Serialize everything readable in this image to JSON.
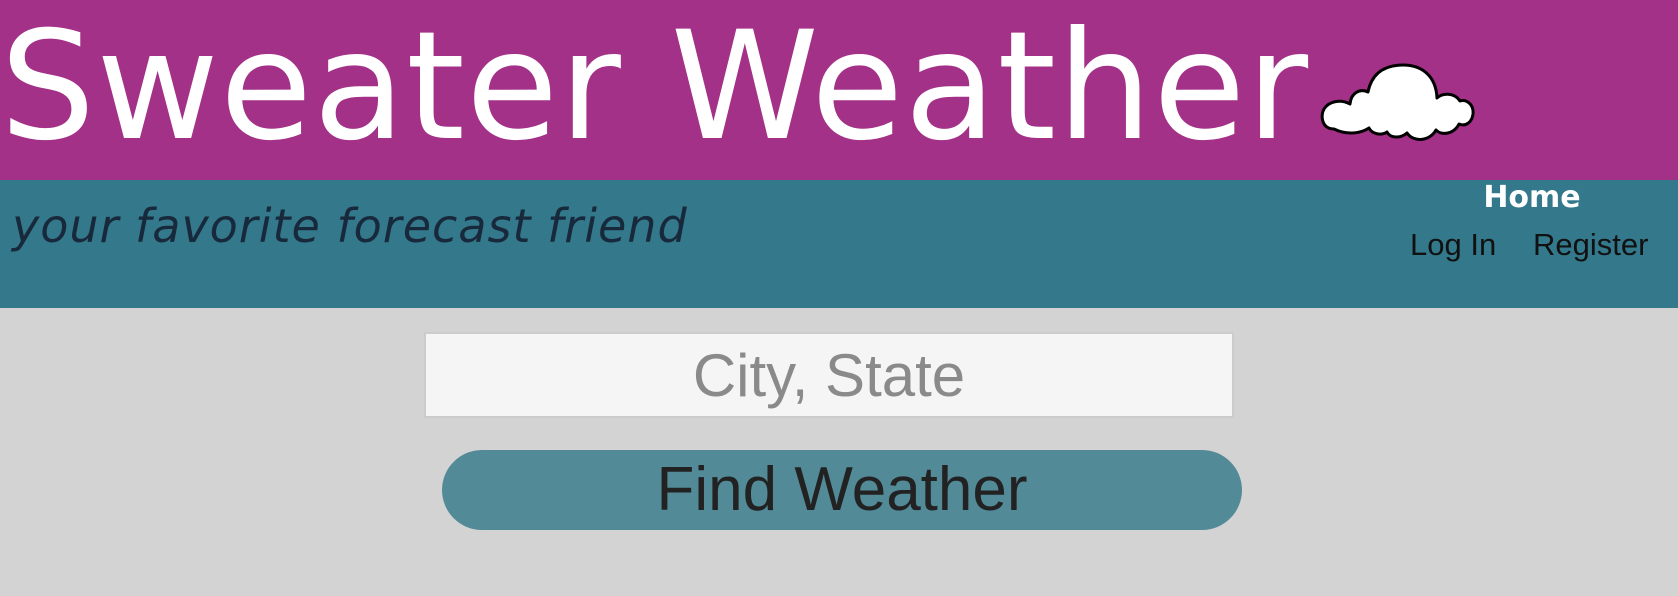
{
  "header": {
    "title": "Sweater Weather",
    "logo_icon": "cloud-icon",
    "tagline": "your favorite forecast friend"
  },
  "nav": {
    "home": "Home",
    "login": "Log In",
    "register": "Register"
  },
  "search": {
    "placeholder": "City, State",
    "value": "",
    "button_label": "Find Weather"
  },
  "colors": {
    "banner": "#a33188",
    "subbar": "#33788b",
    "page_background": "#d3d3d3",
    "button": "#528a98"
  }
}
